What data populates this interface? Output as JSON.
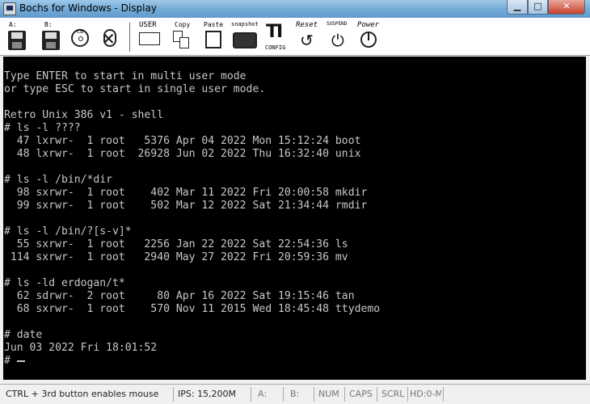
{
  "window": {
    "title": "Bochs for Windows - Display",
    "controls": {
      "minimize": "▁",
      "maximize": "□",
      "close": "✕"
    }
  },
  "toolbar": {
    "floppy_a_label": "A:",
    "floppy_b_label": "B:",
    "cdrom_label": "CD",
    "user_label": "USER",
    "copy_label": "Copy",
    "paste_label": "Paste",
    "snapshot_label": "snapshot",
    "config_label": "CONFIG",
    "reset_label": "Reset",
    "suspend_label": "SUSPEND",
    "power_label": "Power"
  },
  "console": {
    "text": "Type ENTER to start in multi user mode\nor type ESC to start in single user mode.\n\nRetro Unix 386 v1 - shell\n# ls -l ????\n  47 lxrwr-  1 root   5376 Apr 04 2022 Mon 15:12:24 boot\n  48 lxrwr-  1 root  26928 Jun 02 2022 Thu 16:32:40 unix\n\n# ls -l /bin/*dir\n  98 sxrwr-  1 root    402 Mar 11 2022 Fri 20:00:58 mkdir\n  99 sxrwr-  1 root    502 Mar 12 2022 Sat 21:34:44 rmdir\n\n# ls -l /bin/?[s-v]*\n  55 sxrwr-  1 root   2256 Jan 22 2022 Sat 22:54:36 ls\n 114 sxrwr-  1 root   2940 May 27 2022 Fri 20:59:36 mv\n\n# ls -ld erdogan/t*\n  62 sdrwr-  2 root     80 Apr 16 2022 Sat 19:15:46 tan\n  68 sxrwr-  1 root    570 Nov 11 2015 Wed 18:45:48 ttydemo\n\n# date\nJun 03 2022 Fri 18:01:52\n# "
  },
  "status": {
    "mouse_hint": "CTRL + 3rd button enables mouse",
    "ips": "IPS: 15,200M",
    "drive_a": "A:",
    "drive_b": "B:",
    "num": "NUM",
    "caps": "CAPS",
    "scrl": "SCRL",
    "hd": "HD:0-M"
  },
  "icons": [
    "app-icon",
    "floppy-a-icon",
    "floppy-b-icon",
    "cdrom-icon",
    "user-icon",
    "copy-icon",
    "paste-icon",
    "snapshot-icon",
    "config-icon",
    "reset-icon",
    "suspend-icon",
    "power-icon"
  ]
}
